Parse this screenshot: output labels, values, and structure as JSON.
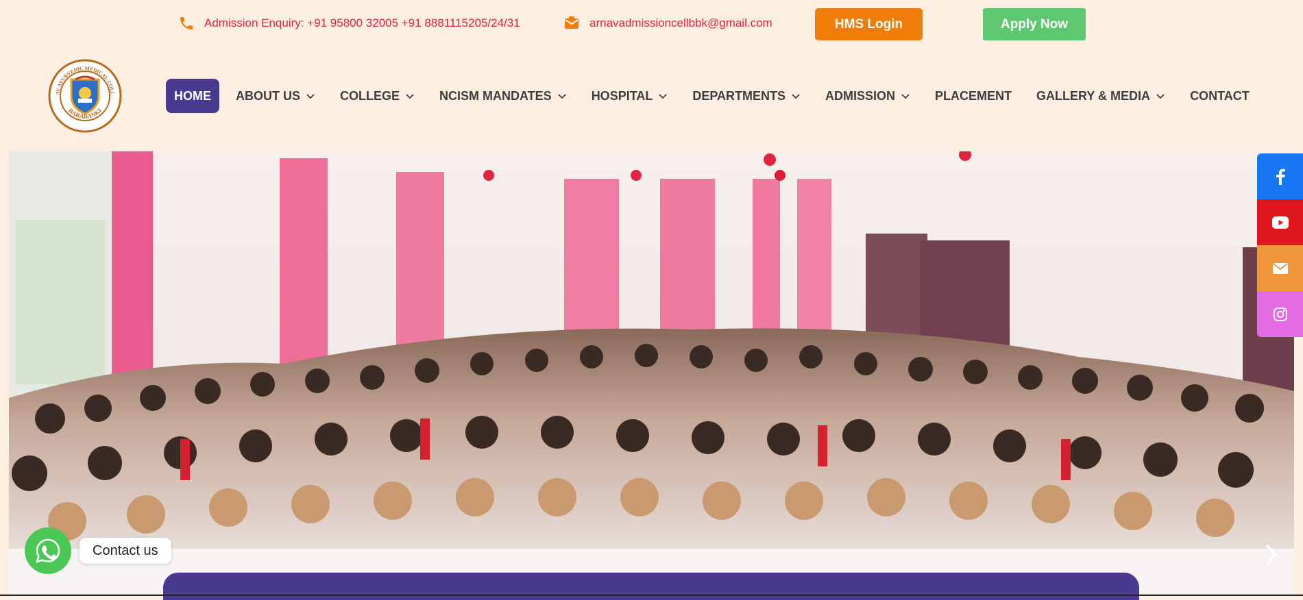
{
  "topbar": {
    "admission_enquiry": "Admission Enquiry: +91 95800 32005 +91 8881115205/24/31",
    "email": "arnavadmissioncellbbk@gmail.com",
    "hms_login": "HMS Login",
    "apply_now": "Apply Now",
    "phone_icon": "phone-icon",
    "email_icon": "envelope-icon"
  },
  "logo": {
    "icon": "college-emblem-logo",
    "ring_text": "ARNAV AYURVEDIC MEDICAL COLLEGE",
    "city_text": "BARABANKI"
  },
  "nav": {
    "items": [
      {
        "label": "HOME",
        "active": true,
        "dropdown": false
      },
      {
        "label": "ABOUT US",
        "active": false,
        "dropdown": true
      },
      {
        "label": "COLLEGE",
        "active": false,
        "dropdown": true
      },
      {
        "label": "NCISM MANDATES",
        "active": false,
        "dropdown": true
      },
      {
        "label": "HOSPITAL",
        "active": false,
        "dropdown": true
      },
      {
        "label": "DEPARTMENTS",
        "active": false,
        "dropdown": true
      },
      {
        "label": "ADMISSION",
        "active": false,
        "dropdown": true
      },
      {
        "label": "PLACEMENT",
        "active": false,
        "dropdown": false
      },
      {
        "label": "GALLERY & MEDIA",
        "active": false,
        "dropdown": true
      },
      {
        "label": "CONTACT",
        "active": false,
        "dropdown": false
      }
    ]
  },
  "hero": {
    "image": "group-photo-students-in-white-coats-taking-oath",
    "prev_icon": "chevron-left-icon",
    "next_icon": "chevron-right-icon"
  },
  "social": [
    {
      "icon": "facebook-icon",
      "color": "#1877f2"
    },
    {
      "icon": "youtube-icon",
      "color": "#e0161d"
    },
    {
      "icon": "email-icon",
      "color": "#f0963c"
    },
    {
      "icon": "instagram-icon",
      "color": "#e36ce6"
    }
  ],
  "whatsapp": {
    "label": "Contact us",
    "icon": "whatsapp-icon",
    "color": "#4bc756"
  },
  "colors": {
    "background": "#fdeee2",
    "nav_active": "#4a3a8f",
    "hms_button": "#f07d0a",
    "apply_button": "#5dc86f",
    "contact_text": "#e3263f"
  }
}
